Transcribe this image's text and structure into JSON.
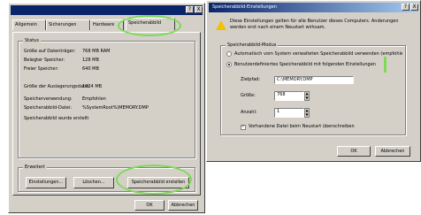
{
  "left_window": {
    "tabs": [
      "Allgemein",
      "Sicherungen",
      "Hardware",
      "Speicherabbild"
    ],
    "active_tab": 3,
    "info_group": {
      "title": "Status",
      "rows": [
        {
          "label": "Größe auf Datenträger:",
          "value": "768 MB RAM"
        },
        {
          "label": "Belegter Speicher:",
          "value": "128 MB"
        },
        {
          "label": "Freier Speicher:",
          "value": "640 MB"
        },
        {
          "label": "Größe der Auslagerungsdatei:",
          "value": "1024 MB"
        },
        {
          "label": "Speicherverwendung:",
          "value": "Empfohlen"
        },
        {
          "label": "Speicherabbild-Datei:",
          "value": "%SystemRoot%\\MEMORY.DMP"
        }
      ],
      "note": "Speicherabbild wurde erstellt"
    },
    "bottom_group": {
      "title": "Erweitert",
      "buttons": [
        "Einstellungen...",
        "Löschen...",
        "Speicherabbild erstellen"
      ]
    },
    "ok_label": "OK",
    "cancel_label": "Abbrechen",
    "title_buttons": [
      "?",
      "X"
    ]
  },
  "right_window": {
    "title": "Speicherabbild-Einstellungen",
    "warning_text": "Diese Einstellungen gelten für alle Benutzer dieses Computers. Änderungen werden erst nach einem Neustart wirksam.",
    "options_group": {
      "title": "Speicherabbild-Modus",
      "radios": [
        {
          "label": "Automatisch vom System verwalteten Speicherabbild verwenden (empfohlen)",
          "checked": false
        },
        {
          "label": "Benutzerdefiniertes Speicherabbild mit folgenden Einstellungen",
          "checked": true
        }
      ],
      "fields": [
        {
          "label": "Zielpfad:",
          "value": "C:\\MEMORY.DMP"
        },
        {
          "label": "Größe:",
          "value": "768"
        },
        {
          "label": "Anzahl:",
          "value": "1"
        }
      ],
      "checkbox_label": "Vorhandene Datei beim Neustart überschreiben",
      "checkbox_checked": true
    },
    "ok_label": "OK",
    "cancel_label": "Abbrechen",
    "title_buttons": [
      "?",
      "X"
    ]
  },
  "colors": {
    "face": "#d4d0c8",
    "title_left": "#0a246a",
    "title_right": "#a6caf0",
    "highlight": "#7ed957"
  }
}
